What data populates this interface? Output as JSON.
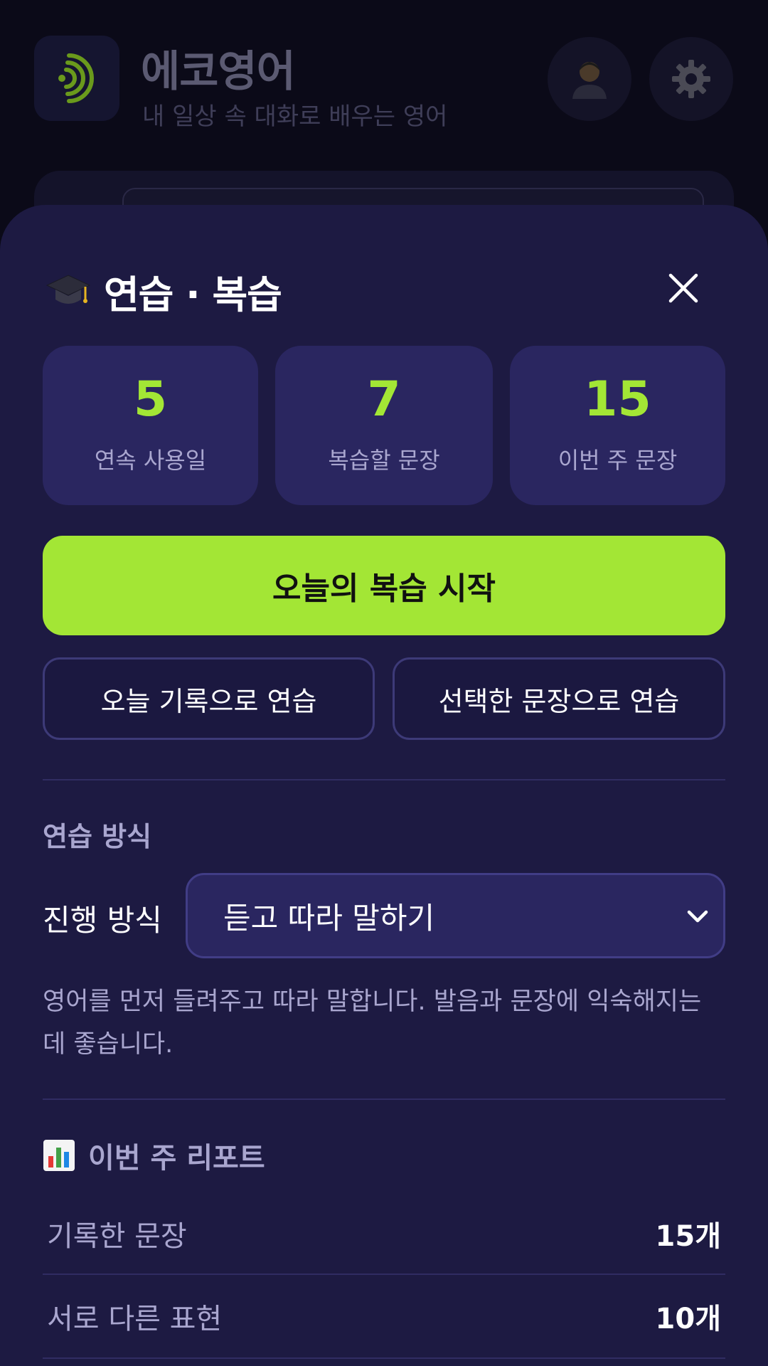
{
  "app": {
    "title": "에코영어",
    "subtitle": "내 일상 속 대화로 배우는 영어"
  },
  "sheet": {
    "title": "연습 · 복습",
    "stats": [
      {
        "value": "5",
        "label": "연속 사용일"
      },
      {
        "value": "7",
        "label": "복습할 문장"
      },
      {
        "value": "15",
        "label": "이번 주 문장"
      }
    ],
    "primary_label": "오늘의 복습 시작",
    "practice_today_label": "오늘 기록으로 연습",
    "practice_selected_label": "선택한 문장으로 연습",
    "mode_section_title": "연습 방식",
    "mode_label": "진행 방식",
    "mode_selected": "듣고 따라 말하기",
    "mode_description": "영어를 먼저 들려주고 따라 말합니다. 발음과 문장에 익숙해지는 데 좋습니다.",
    "report_title": "이번 주 리포트",
    "report_rows": [
      {
        "key": "기록한 문장",
        "value": "15개"
      },
      {
        "key": "서로 다른 표현",
        "value": "10개"
      }
    ]
  },
  "icons": {
    "logo": "sound-wave-icon",
    "profile": "person-icon",
    "settings": "gear-icon",
    "title": "graduation-cap-icon",
    "close": "close-icon",
    "select": "chevron-down-icon",
    "report": "bar-chart-icon"
  },
  "colors": {
    "accent": "#a3e635",
    "sheet_bg": "#1d1a42",
    "card_bg": "#2a2660",
    "muted_text": "#a9a6cf"
  }
}
